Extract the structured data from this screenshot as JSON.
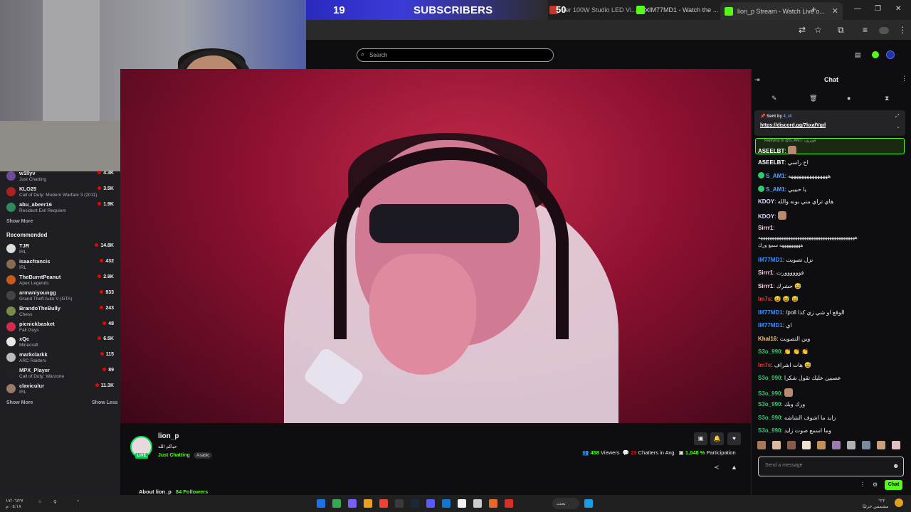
{
  "subscriber_overlay": {
    "count": "19",
    "label": "SUBSCRIBERS"
  },
  "browser": {
    "tabs": [
      {
        "label": "50",
        "desc": "ser 100W Studio LED Vi..."
      },
      {
        "label": "IM77MD1 - Watch the ..."
      },
      {
        "label": "lion_p Stream - Watch Live o..."
      }
    ],
    "new_tab": "+",
    "window_controls": [
      "—",
      "❐",
      "✕"
    ]
  },
  "twitch_header": {
    "search_placeholder": "Search"
  },
  "sidebar": {
    "followed": [
      {
        "name": "w1llyv",
        "game": "Just Chatting",
        "viewers": "4.3K",
        "color": "#6b4b9a"
      },
      {
        "name": "KLO25",
        "game": "Call of Duty: Modern Warfare 3 (2011)",
        "viewers": "3.5K",
        "color": "#b02020"
      },
      {
        "name": "abu_abeer16",
        "game": "Resident Evil Requiem",
        "viewers": "1.9K",
        "color": "#2e8b57"
      }
    ],
    "show_more": "Show More",
    "recommended_title": "Recommended",
    "recommended": [
      {
        "name": "TJR",
        "game": "IRL",
        "viewers": "14.8K",
        "color": "#dddddd"
      },
      {
        "name": "isaacfrancis",
        "game": "IRL",
        "viewers": "432",
        "color": "#8a6b50"
      },
      {
        "name": "TheBurntPeanut",
        "game": "Apex Legends",
        "viewers": "2.9K",
        "color": "#c85a1e"
      },
      {
        "name": "armaniyoungg",
        "game": "Grand Theft Auto V (GTA)",
        "viewers": "933",
        "color": "#444444"
      },
      {
        "name": "BrandoTheBully",
        "game": "Chess",
        "viewers": "243",
        "color": "#7a8a4a"
      },
      {
        "name": "picnickbasket",
        "game": "Fall Guys",
        "viewers": "48",
        "color": "#d62a4a"
      },
      {
        "name": "xQc",
        "game": "Minecraft",
        "viewers": "6.5K",
        "color": "#e8e8e8"
      },
      {
        "name": "markclarkk",
        "game": "ARC Raiders",
        "viewers": "115",
        "color": "#bbbbbb"
      },
      {
        "name": "MPX_Player",
        "game": "Call of Duty: Warzone",
        "viewers": "89",
        "color": "#222222"
      },
      {
        "name": "claviculur",
        "game": "IRL",
        "viewers": "11.3K",
        "color": "#9a7a6a"
      }
    ],
    "show_more_2": "Show More",
    "show_less": "Show Less"
  },
  "stream": {
    "streamer": "lion_p",
    "title": "حياكم الله",
    "category": "Just Chatting",
    "language": "Arabic",
    "live_label": "LIVE",
    "viewers": "458",
    "viewers_label": "Viewers",
    "chatters": "29",
    "chatters_label": "Chatters in Avg.",
    "participation": "1,048 %",
    "participation_label": "Participation",
    "about": "About lion_p",
    "followers": "84 Followers"
  },
  "chat": {
    "title": "Chat",
    "pinned_by_label": "Sent by",
    "pinned_by_user": "4_i4",
    "pinned_link": "https://discord.gg/7kxafVgd",
    "reply_to": "Replying to @S_AM1: فويرون",
    "messages": [
      {
        "user": "ASEELBT",
        "color": "#ffffff",
        "text": "",
        "emote": true
      },
      {
        "user": "ASEELBT",
        "color": "#ffffff",
        "text": "اح راسي"
      },
      {
        "user": "S_AM1",
        "color": "#5aa0ff",
        "badge": true,
        "text": "هههههههههههههههه"
      },
      {
        "user": "S_AM1",
        "color": "#5aa0ff",
        "badge": true,
        "text": "يا حبيبي"
      },
      {
        "user": "KDOY",
        "color": "#e0d0ff",
        "text": "هاي تراي مني بونه والله"
      },
      {
        "user": "KDOY",
        "color": "#e0d0ff",
        "text": "",
        "emote": true
      },
      {
        "user": "Sirrr1",
        "color": "#ffd0e0",
        "text": ""
      },
      {
        "user": "",
        "color": "#ffffff",
        "text": "ههههههههههههههههههههههههههههههههههههههههههه"
      },
      {
        "user": "",
        "color": "#ffffff",
        "text": "هههههههههه سمع ورك"
      },
      {
        "user": "IM77MD1",
        "color": "#3c8cff",
        "text": "نزل تصويت"
      },
      {
        "user": "Sirrr1",
        "color": "#ffd0e0",
        "text": "فوووووورت"
      },
      {
        "user": "Sirrr1",
        "color": "#ffd0e0",
        "text": "حشرك 😅"
      },
      {
        "user": "Im7s",
        "color": "#e53935",
        "text": "😅 😅 😅"
      },
      {
        "user": "IM77MD1",
        "color": "#3c8cff",
        "text": "/poll الوقع او شي زي كذا"
      },
      {
        "user": "IM77MD1",
        "color": "#3c8cff",
        "text": "اي"
      },
      {
        "user": "Khal16",
        "color": "#f5c26b",
        "text": "وين التصويت"
      },
      {
        "user": "S3o_990",
        "color": "#2ecc71",
        "text": "👏 👏 👏"
      },
      {
        "user": "Im7s",
        "color": "#e53935",
        "text": "هات اشراف 😅"
      },
      {
        "user": "S3o_990",
        "color": "#2ecc71",
        "text": "عصبين عليك تقول شكرا"
      },
      {
        "user": "S3o_990",
        "color": "#2ecc71",
        "text": "",
        "emote": true
      },
      {
        "user": "S3o_990",
        "color": "#2ecc71",
        "text": "ورك وبك"
      },
      {
        "user": "S3o_990",
        "color": "#2ecc71",
        "text": "زايد ما اشوف الشاشه"
      },
      {
        "user": "S3o_990",
        "color": "#2ecc71",
        "text": "وما اسمع صوت زايد"
      }
    ],
    "input_placeholder": "Send a message",
    "send_button": "Chat"
  },
  "taskbar": {
    "weather": "°٢٢",
    "weather_sub": "مشمس جزئيًا",
    "search": "بحث",
    "date": "١٧/٠٦/٢٧",
    "time": "٠٥:١٨ م"
  },
  "colors": {
    "kick_green": "#53fc18",
    "live_red": "#eb0400",
    "bg": "#0e0e10",
    "sidebar": "#1f1f23"
  }
}
